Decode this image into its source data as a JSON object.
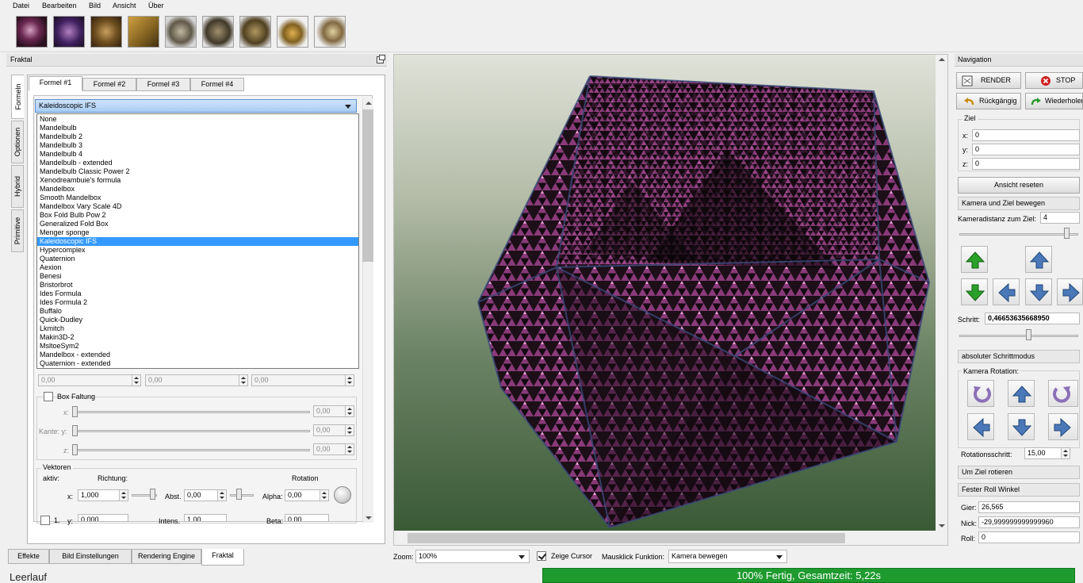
{
  "menu": [
    "Datei",
    "Bearbeiten",
    "Bild",
    "Ansicht",
    "Über"
  ],
  "toolbar": {
    "presets": [
      "preset-mandelbulb-icon",
      "preset-ifs-icosahedron-icon",
      "preset-mandelbox-icon",
      "preset-cube-icon",
      "preset-abox-icon",
      "preset-menger-icon",
      "preset-gear-icon",
      "preset-pyramid-icon",
      "preset-ornament-icon"
    ]
  },
  "left_dock": {
    "title": "Fraktal",
    "side_tabs": [
      "Formeln",
      "Optionen",
      "Hybrid",
      "Primitive"
    ],
    "formula_tabs": [
      "Formel #1",
      "Formel #2",
      "Formel #3",
      "Formel #4"
    ],
    "combo_value": "Kaleidoscopic IFS",
    "dropdown_items": [
      "None",
      "Mandelbulb",
      "Mandelbulb 2",
      "Mandelbulb 3",
      "Mandelbulb 4",
      "Mandelbulb - extended",
      "Mandelbulb Classic Power 2",
      "Xenodreambuie's formula",
      "Mandelbox",
      "Smooth Mandelbox",
      "Mandelbox Vary Scale 4D",
      "Box Fold Bulb Pow 2",
      "Generalized Fold Box",
      "Menger sponge",
      "Kaleidoscopic IFS",
      "Hypercomplex",
      "Quaternion",
      "Aexion",
      "Benesi",
      "Bristorbrot",
      "Ides Formula",
      "Ides Formula 2",
      "Buffalo",
      "Quick-Dudley",
      "Lkmitch",
      "Makin3D-2",
      "MsltoeSym2",
      "Mandelbox - extended",
      "Quaternion - extended"
    ],
    "selected_index": 14,
    "offset_values": [
      "0,00",
      "0,00",
      "0,00"
    ],
    "box_fold": {
      "title": "Box Faltung",
      "label_x": "x:",
      "label_y": "Kante: y:",
      "label_z": "z:",
      "values": [
        "0,00",
        "0,00",
        "0,00"
      ]
    },
    "vectors": {
      "title": "Vektoren",
      "active_label": "aktiv:",
      "direction_label": "Richtung:",
      "rotation_label": "Rotation",
      "x_label": "x:",
      "x_value": "1,000",
      "abst_label": "Abst.",
      "abst_value": "0,00",
      "alpha_label": "Alpha:",
      "alpha_value": "0,00",
      "row2_label": "1.",
      "y_label": "y:",
      "y_value": "0,000",
      "intens_label": "Intens.",
      "intens_value": "1,00",
      "beta_label": "Beta:",
      "beta_value": "0,00"
    }
  },
  "bottom_tabs": [
    "Effekte",
    "Bild Einstellungen",
    "Rendering Engine",
    "Fraktal"
  ],
  "status_text": "Leerlauf",
  "viewport": {
    "zoom_label": "Zoom:",
    "zoom_value": "100%",
    "show_cursor_label": "Zeige Cursor",
    "mouse_function_label": "Mausklick Funktion:",
    "mouse_function_value": "Kamera bewegen"
  },
  "progress": {
    "text": "100% Fertig, Gesamtzeit: 5,22s",
    "value": 1.0
  },
  "nav": {
    "title": "Navigation",
    "render_label": "RENDER",
    "stop_label": "STOP",
    "undo_label": "Rückgängig",
    "redo_label": "Wiederholen",
    "target_title": "Ziel",
    "x_label": "x:",
    "y_label": "y:",
    "z_label": "z:",
    "x_value": "0",
    "y_value": "0",
    "z_value": "0",
    "reset_view_label": "Ansicht reseten",
    "move_camera_label": "Kamera und Ziel bewegen",
    "distance_label": "Kameradistanz zum Ziel:",
    "distance_value": "4",
    "step_label": "Schritt:",
    "step_value": "0,46653635668950",
    "absolute_step_label": "absoluter Schrittmodus",
    "camera_rotation_label": "Kamera Rotation:",
    "rotation_step_label": "Rotationsschritt:",
    "rotation_step_value": "15,00",
    "rotate_target_label": "Um Ziel rotieren",
    "fixed_roll_label": "Fester Roll Winkel",
    "yaw_label": "Gier:",
    "yaw_value": "26,565",
    "pitch_label": "Nick:",
    "pitch_value": "-29,999999999999960",
    "roll_label": "Roll:",
    "roll_value": "0"
  },
  "colors": {
    "accent": "#3399ff",
    "progress_green": "#1e9a2e",
    "stop_red": "#d02020",
    "arrow_green": "#2aa02a",
    "arrow_blue": "#4a78b8",
    "arrow_purple": "#8a70b8"
  }
}
